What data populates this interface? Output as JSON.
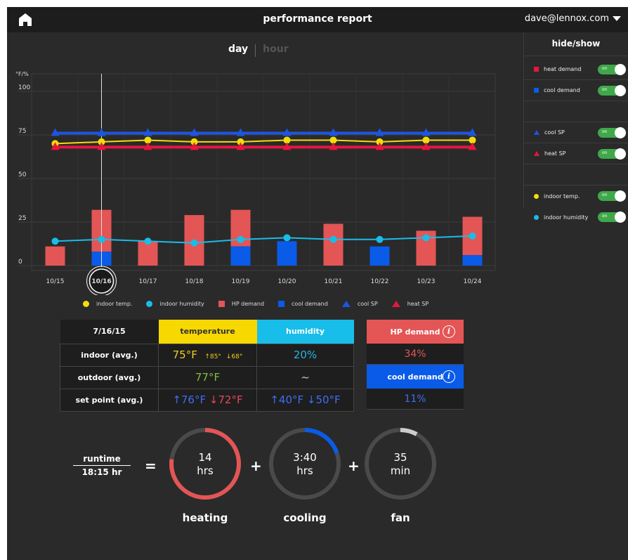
{
  "header": {
    "title": "performance report",
    "user": "dave@lennox.com"
  },
  "tabs": {
    "day": "day",
    "hour": "hour"
  },
  "panel": {
    "title": "hide/show",
    "items": [
      {
        "label": "heat demand",
        "marker": "square",
        "color": "#e8163c",
        "toggle": "on"
      },
      {
        "label": "cool demand",
        "marker": "square",
        "color": "#0a5be8",
        "toggle": "on"
      },
      {
        "label": "cool SP",
        "marker": "triangle",
        "color": "#1c55e0",
        "toggle": "on"
      },
      {
        "label": "heat SP",
        "marker": "triangle",
        "color": "#e8163c",
        "toggle": "on"
      },
      {
        "label": "indoor temp.",
        "marker": "circle",
        "color": "#f5dc0a",
        "toggle": "on"
      },
      {
        "label": "indoor humidity",
        "marker": "circle",
        "color": "#19bde9",
        "toggle": "on"
      }
    ]
  },
  "chart_data": {
    "type": "bar",
    "ylabel": "°F/%",
    "yticks": [
      "100",
      "75",
      "50",
      "25",
      "0"
    ],
    "ylim": [
      0,
      100
    ],
    "categories": [
      "10/15",
      "10/16",
      "10/17",
      "10/18",
      "10/19",
      "10/20",
      "10/21",
      "10/22",
      "10/23",
      "10/24"
    ],
    "selected_category": "10/16",
    "grid": true,
    "series": [
      {
        "name": "HP demand",
        "type": "bar",
        "color": "#e45555",
        "values": [
          11,
          24,
          14,
          29,
          21,
          0,
          24,
          0,
          20,
          22
        ]
      },
      {
        "name": "cool demand",
        "type": "bar",
        "color": "#0a5be8",
        "values": [
          0,
          8,
          0,
          0,
          11,
          14,
          0,
          11,
          0,
          6
        ]
      },
      {
        "name": "indoor temp.",
        "type": "line",
        "color": "#f5dc0a",
        "values": [
          70,
          71,
          72,
          71,
          71,
          72,
          72,
          71,
          72,
          72
        ]
      },
      {
        "name": "indoor humidity",
        "type": "line",
        "color": "#19bde9",
        "values": [
          14,
          15,
          14,
          13,
          15,
          16,
          15,
          15,
          16,
          17
        ]
      },
      {
        "name": "cool SP",
        "type": "line",
        "color": "#1c55e0",
        "values": [
          76,
          76,
          76,
          76,
          76,
          76,
          76,
          76,
          76,
          76
        ]
      },
      {
        "name": "heat SP",
        "type": "line",
        "color": "#e8163c",
        "values": [
          68,
          68,
          68,
          68,
          68,
          68,
          68,
          68,
          68,
          68
        ]
      }
    ]
  },
  "legend": {
    "indoor_temp": "indoor temp.",
    "indoor_humidity": "indoor humidity",
    "hp_demand": "HP demand",
    "cool_demand": "cool demand",
    "cool_sp": "cool SP",
    "heat_sp": "heat SP"
  },
  "stats": {
    "date": "7/16/15",
    "col_temperature": "temperature",
    "col_humidity": "humidity",
    "indoor": {
      "label": "indoor (avg.)",
      "temp": "75°F",
      "high": "↑85°",
      "low": "↓68°",
      "humidity": "20%"
    },
    "outdoor": {
      "label": "outdoor (avg.)",
      "temp": "77°F",
      "humidity": "~"
    },
    "setpoint": {
      "label": "set point (avg.)",
      "temp_cool": "↑76°F",
      "temp_heat": "↓72°F",
      "humidity": "↑40°F ↓50°F"
    }
  },
  "demand": {
    "hp_label": "HP demand",
    "hp_value": "34%",
    "hp_color": "#e45555",
    "cool_label": "cool demand",
    "cool_value": "11%",
    "cool_color": "#0a5be8",
    "info_icon": "i"
  },
  "runtime": {
    "label": "runtime",
    "total": "18:15 hr",
    "equals": "=",
    "plus": "+",
    "heating": {
      "value": "14",
      "unit": "hrs",
      "caption": "heating",
      "fraction": 0.77,
      "color": "#e45555"
    },
    "cooling": {
      "value": "3:40",
      "unit": "hrs",
      "caption": "cooling",
      "fraction": 0.2,
      "color": "#0a5be8"
    },
    "fan": {
      "value": "35",
      "unit": "min",
      "caption": "fan",
      "fraction": 0.08,
      "color": "#cccccc"
    }
  }
}
